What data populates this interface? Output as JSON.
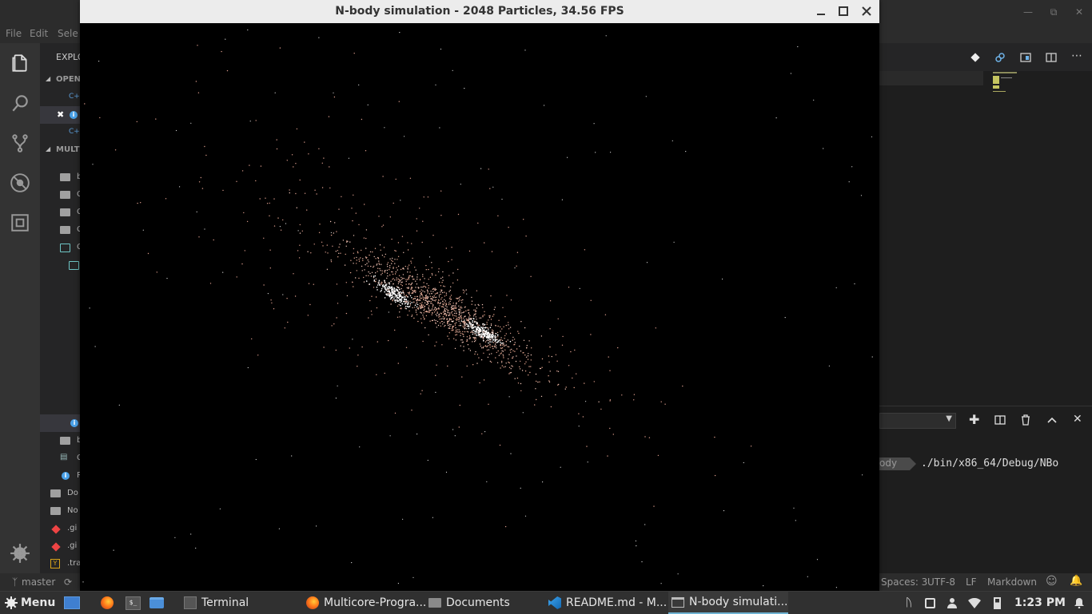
{
  "vscode": {
    "menu": [
      "File",
      "Edit",
      "Sele"
    ],
    "sidebar_labels": {
      "explorer": "EXPLO",
      "open_editors": "OPEN",
      "project": "MULT",
      "rows": [
        "b",
        "C",
        "C",
        "C",
        "C",
        "b",
        "C",
        "R",
        "Do",
        "No",
        ".gi",
        ".gi",
        ".tra"
      ]
    },
    "terminal": {
      "tag": "ody",
      "command": "./bin/x86_64/Debug/NBo"
    },
    "status": {
      "branch": "master",
      "spaces": "Spaces: 3",
      "encoding": "UTF-8",
      "eol": "LF",
      "language": "Markdown"
    }
  },
  "nbody_window": {
    "title": "N-body simulation - 2048 Particles, 34.56 FPS",
    "minimize_icon": "minimize-icon",
    "maximize_icon": "maximize-icon",
    "close_icon": "close-icon"
  },
  "taskbar": {
    "menu_label": "Menu",
    "items": [
      {
        "label": "Terminal",
        "icon": "terminal-icon"
      },
      {
        "label": "Multicore-Progra...",
        "icon": "firefox-icon"
      },
      {
        "label": "Documents",
        "icon": "folder-icon"
      },
      {
        "label": "README.md - M...",
        "icon": "vscode-icon"
      },
      {
        "label": "N-body simulati...",
        "icon": "window-icon"
      }
    ],
    "clock": "1:23 PM"
  }
}
